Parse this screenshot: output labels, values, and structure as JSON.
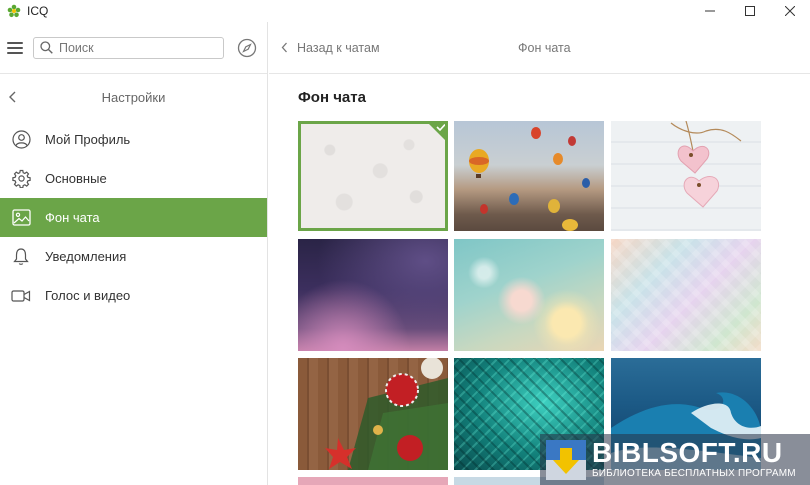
{
  "app": {
    "title": "ICQ",
    "icon": "icq-flower-icon",
    "brand_color": "#6ba548"
  },
  "window_controls": {
    "minimize": "—",
    "maximize": "☐",
    "close": "✕"
  },
  "search": {
    "placeholder": "Поиск",
    "value": ""
  },
  "settings": {
    "title": "Настройки",
    "items": [
      {
        "label": "Мой Профиль",
        "icon": "profile-icon",
        "active": false
      },
      {
        "label": "Основные",
        "icon": "gear-icon",
        "active": false
      },
      {
        "label": "Фон чата",
        "icon": "image-icon",
        "active": true
      },
      {
        "label": "Уведомления",
        "icon": "bell-icon",
        "active": false
      },
      {
        "label": "Голос и видео",
        "icon": "video-camera-icon",
        "active": false
      }
    ]
  },
  "main": {
    "back_label": "Назад к чатам",
    "header_title": "Фон чата",
    "section_title": "Фон чата",
    "wallpapers": [
      {
        "name": "doodle-pattern",
        "selected": true
      },
      {
        "name": "hot-air-balloons",
        "selected": false
      },
      {
        "name": "pink-hearts-on-wood",
        "selected": false
      },
      {
        "name": "dark-purple-bokeh",
        "selected": false
      },
      {
        "name": "pastel-heart-bokeh",
        "selected": false
      },
      {
        "name": "pastel-geometric",
        "selected": false
      },
      {
        "name": "christmas-ornaments",
        "selected": false
      },
      {
        "name": "teal-mosaic",
        "selected": false
      },
      {
        "name": "ocean-wave",
        "selected": false
      }
    ]
  },
  "watermark": {
    "title": "BIBLSOFT.RU",
    "subtitle": "БИБЛИОТЕКА БЕСПЛАТНЫХ ПРОГРАММ"
  }
}
